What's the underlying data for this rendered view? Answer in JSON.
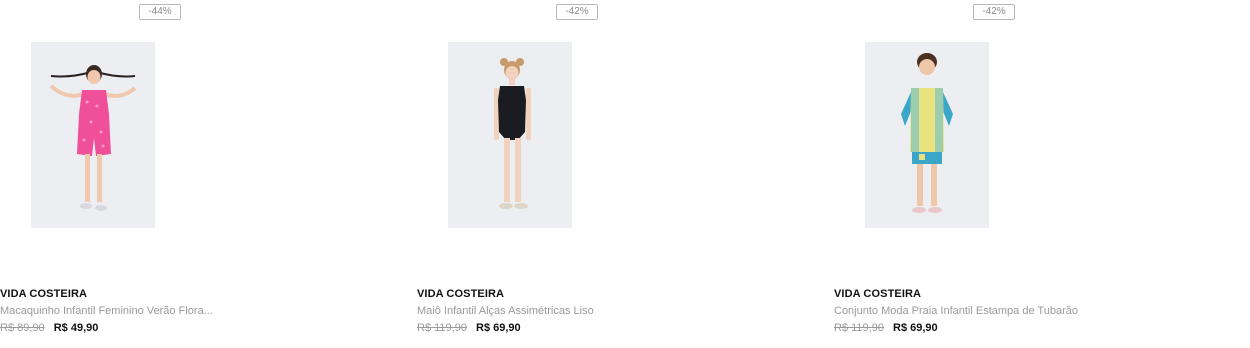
{
  "products": [
    {
      "discount": "-44%",
      "brand": "VIDA COSTEIRA",
      "name": "Macaquinho Infantil Feminino Verão Flora...",
      "old_price": "R$ 89,90",
      "price": "R$ 49,90"
    },
    {
      "discount": "-42%",
      "brand": "VIDA COSTEIRA",
      "name": "Maiô Infantil Alças Assimétricas Liso",
      "old_price": "R$ 119,90",
      "price": "R$ 69,90"
    },
    {
      "discount": "-42%",
      "brand": "VIDA COSTEIRA",
      "name": "Conjunto Moda Praia Infantil Estampa de Tubarão",
      "old_price": "R$ 119,90",
      "price": "R$ 69,90"
    }
  ]
}
